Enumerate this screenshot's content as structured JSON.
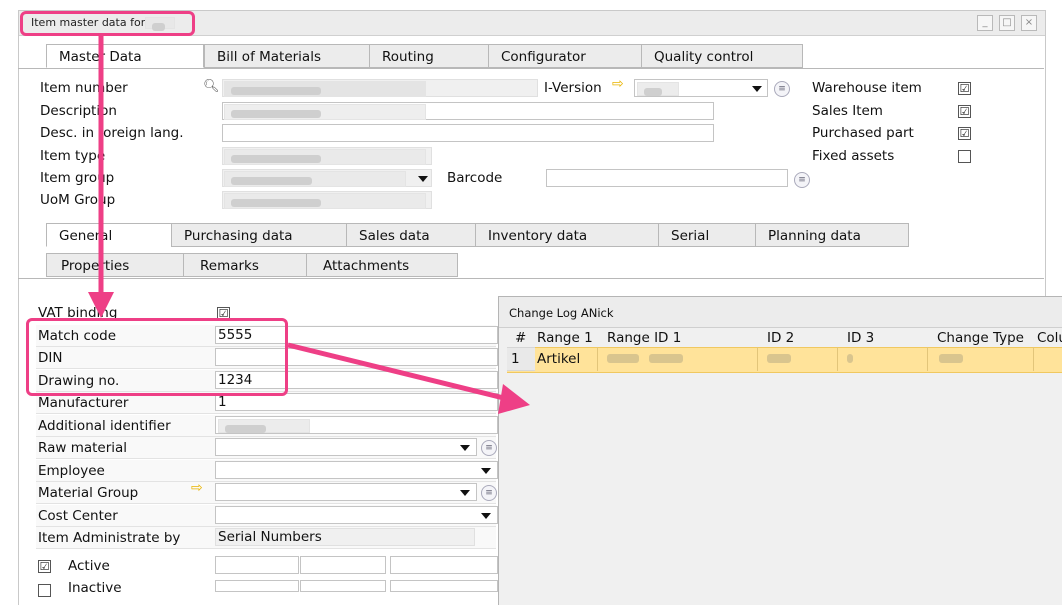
{
  "window": {
    "title": "Item master data for ",
    "min_label": "_",
    "max_label": "□",
    "close_label": "×"
  },
  "main_tabs": [
    {
      "label": "Master Data"
    },
    {
      "label": "Bill of Materials"
    },
    {
      "label": "Routing"
    },
    {
      "label": "Configurator"
    },
    {
      "label": "Quality control"
    }
  ],
  "header": {
    "item_number_label": "Item number",
    "description_label": "Description",
    "foreign_label": "Desc. in foreign lang.",
    "item_type_label": "Item type",
    "item_group_label": "Item group",
    "uom_group_label": "UoM Group",
    "iversion_label": "I-Version",
    "barcode_label": "Barcode"
  },
  "flags": [
    {
      "label": "Warehouse item",
      "checked": "☑"
    },
    {
      "label": "Sales Item",
      "checked": "☑"
    },
    {
      "label": "Purchased part",
      "checked": "☑"
    },
    {
      "label": "Fixed assets",
      "checked": ""
    }
  ],
  "sub_tabs_row1": [
    {
      "label": "General"
    },
    {
      "label": "Purchasing data"
    },
    {
      "label": "Sales data"
    },
    {
      "label": "Inventory data"
    },
    {
      "label": "Serial"
    },
    {
      "label": "Planning data"
    }
  ],
  "sub_tabs_row2": [
    {
      "label": "Properties"
    },
    {
      "label": "Remarks"
    },
    {
      "label": "Attachments"
    }
  ],
  "general": {
    "vat_label": "VAT binding",
    "vat_check": "☑",
    "match_label": "Match code",
    "match_value": "5555",
    "din_label": "DIN",
    "drawing_label": "Drawing no.",
    "drawing_value": "1234",
    "manufacturer_label": "Manufacturer",
    "manufacturer_value": "1",
    "additional_label": "Additional identifier",
    "raw_label": "Raw material",
    "employee_label": "Employee",
    "material_group_label": "Material Group",
    "cost_center_label": "Cost Center",
    "administrate_label": "Item Administrate by",
    "administrate_value": "Serial Numbers",
    "active_label": "Active",
    "active_check": "☑",
    "inactive_label": "Inactive"
  },
  "change_log": {
    "title": "Change Log ANick",
    "columns": [
      "#",
      "Range 1",
      "Range ID 1",
      "ID 2",
      "ID 3",
      "Change Type",
      "Colu"
    ],
    "row": {
      "num": "1",
      "range1": "Artikel"
    }
  }
}
